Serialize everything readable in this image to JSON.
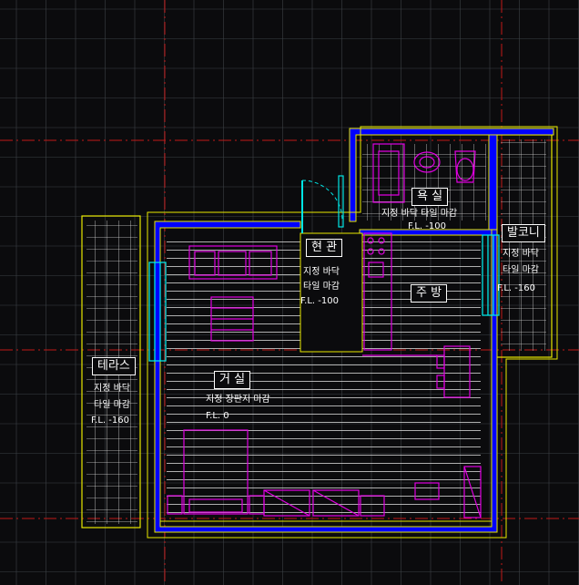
{
  "colors": {
    "background": "#0b0b0d",
    "grid": "#3d4246",
    "axis": "#c01818",
    "wall_outline": "#e8e800",
    "wall_fill": "#0000ff",
    "window": "#00e5e5",
    "furniture": "#e000e0",
    "hatch": "#ffffff"
  },
  "rooms": {
    "bath": {
      "name": "욕 실",
      "finish": "지정 바닥 타일 마감",
      "level": "F.L. -100"
    },
    "entrance": {
      "name": "현 관",
      "finish_1": "지정 바닥",
      "finish_2": "타일 마감",
      "level": "F.L. -100"
    },
    "kitchen": {
      "name": "주 방"
    },
    "balcony": {
      "name": "발코니",
      "finish_1": "지정 바닥",
      "finish_2": "타일 마감",
      "level": "F.L. -160"
    },
    "terrace": {
      "name": "테라스",
      "finish_1": "지정 바닥",
      "finish_2": "타일 마감",
      "level": "F.L. -160"
    },
    "living": {
      "name": "거 실",
      "finish": "지정 장판지 마감",
      "level": "F.L. 0"
    }
  }
}
